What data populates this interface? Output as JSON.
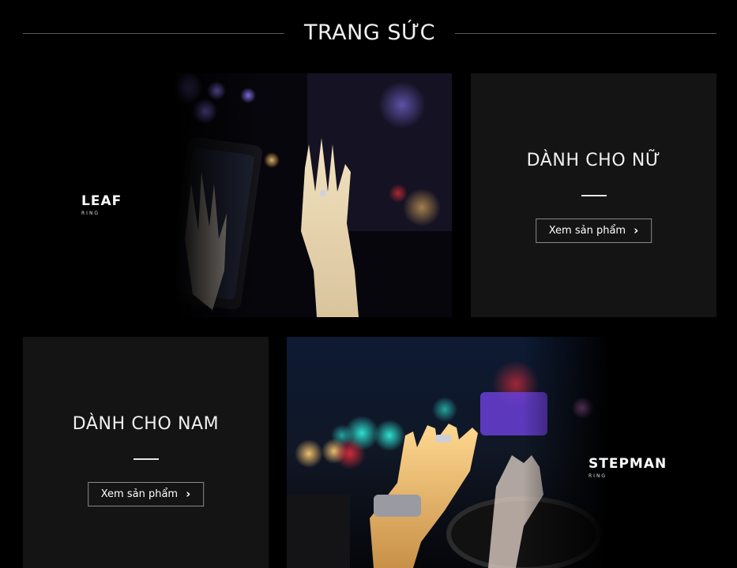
{
  "section": {
    "title": "TRANG SỨC"
  },
  "featured_women": {
    "brand_name": "LEAF",
    "brand_sub": "RING",
    "panel_title": "DÀNH CHO NỮ",
    "button_label": "Xem sản phẩm",
    "button_icon": "chevron-right-icon"
  },
  "featured_men": {
    "brand_name": "STEPMAN",
    "brand_sub": "RING",
    "panel_title": "DÀNH CHO NAM",
    "button_label": "Xem sản phẩm",
    "button_icon": "chevron-right-icon"
  },
  "colors": {
    "background": "#000000",
    "panel": "#141414",
    "text": "#ffffff",
    "divider": "#5a5a5a"
  }
}
